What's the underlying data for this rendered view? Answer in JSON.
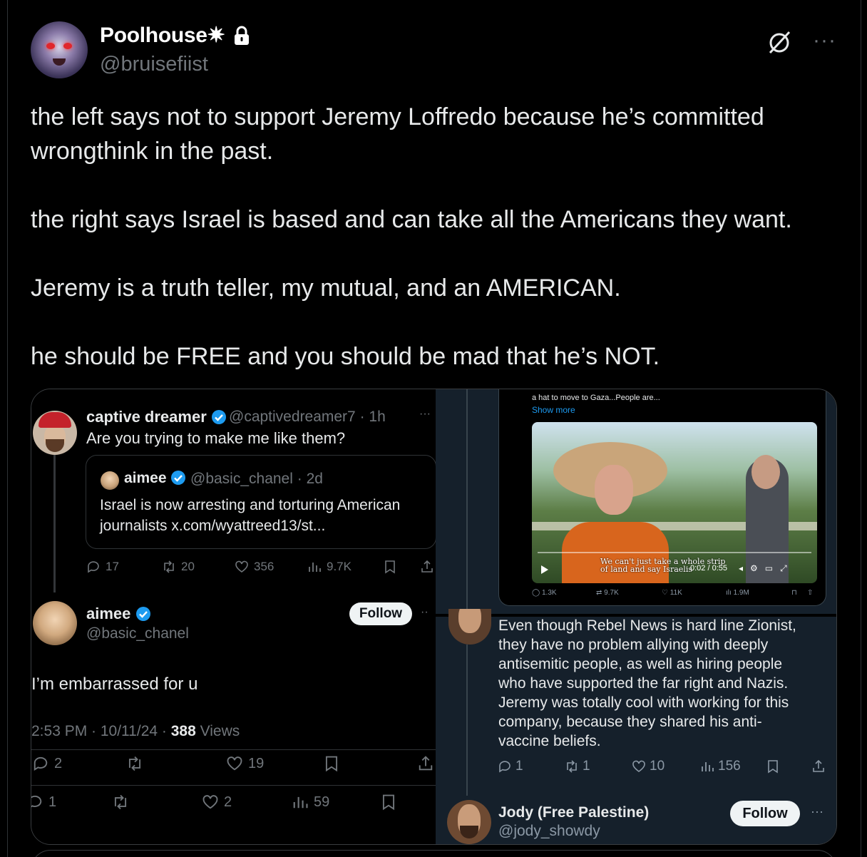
{
  "post": {
    "display_name": "Poolhouse✷",
    "handle": "@bruisefiist",
    "more_label": "···",
    "text": "the left says not to support Jeremy Loffredo because he’s committed wrongthink in the past.\n\nthe right says Israel is based and can take all the Americans they want.\n\nJeremy is a truth teller, my mutual, and an AMERICAN.\n\nhe should be FREE and you should be mad that he’s NOT."
  },
  "left_shot": {
    "tweet1": {
      "name": "captive dreamer",
      "handle": "@captivedreamer7 · 1h",
      "text": "Are you trying to make me like them?",
      "more": "···",
      "quote": {
        "name": "aimee",
        "handle": "@basic_chanel · 2d",
        "text": "Israel is now arresting and torturing American journalists x.com/wyattreed13/st..."
      },
      "metrics": {
        "replies": "17",
        "reposts": "20",
        "likes": "356",
        "views": "9.7K"
      }
    },
    "tweet2": {
      "name": "aimee",
      "handle": "@basic_chanel",
      "follow_label": "Follow",
      "more": "··",
      "text": "I’m embarrassed for u",
      "time": "2:53 PM · 10/11/24 · ",
      "views_count": "388",
      "views_label": " Views",
      "metrics": {
        "replies": "2",
        "likes": "19"
      }
    },
    "reply_row": {
      "replies": "1",
      "likes": "2",
      "views": "59"
    }
  },
  "right_shot": {
    "snippet": "a hat to move to Gaza...People are...",
    "show_more": "Show more",
    "video": {
      "caption_line1": "We can't just take a whole strip",
      "caption_line2": "of land and say Israelis",
      "time": "0:02 / 0:55"
    },
    "video_metrics": {
      "replies": "1.3K",
      "reposts": "9.7K",
      "likes": "11K",
      "views": "1.9M"
    },
    "reply": {
      "text": "Even though Rebel News is hard line Zionist, they have no problem allying with deeply antisemitic people, as well as hiring people who have supported the far right and Nazis. Jeremy was totally cool with working for this company, because they shared his anti-vaccine beliefs.",
      "metrics": {
        "replies": "1",
        "reposts": "1",
        "likes": "10",
        "views": "156"
      }
    },
    "author": {
      "name": "Jody (Free Palestine)",
      "handle": "@jody_showdy",
      "follow_label": "Follow",
      "more": "···"
    }
  },
  "colors": {
    "background": "#000000",
    "muted": "#71767b",
    "verified": "#1d9bf0",
    "right_pane_bg": "#15202b"
  }
}
